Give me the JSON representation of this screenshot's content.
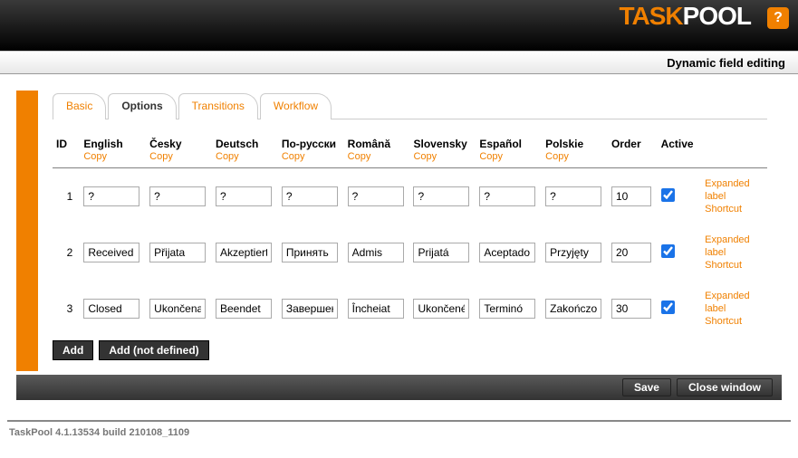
{
  "brand": {
    "part1": "TASK",
    "part2": "POOL"
  },
  "subtitle": "Dynamic field editing",
  "tabs": {
    "basic": "Basic",
    "options": "Options",
    "transitions": "Transitions",
    "workflow": "Workflow"
  },
  "columns": {
    "id": "ID",
    "order": "Order",
    "active": "Active",
    "copy": "Copy"
  },
  "langs": [
    {
      "key": "en",
      "label": "English"
    },
    {
      "key": "cs",
      "label": "Česky"
    },
    {
      "key": "de",
      "label": "Deutsch"
    },
    {
      "key": "ru",
      "label": "По-русски"
    },
    {
      "key": "ro",
      "label": "Română"
    },
    {
      "key": "sk",
      "label": "Slovensky"
    },
    {
      "key": "es",
      "label": "Español"
    },
    {
      "key": "pl",
      "label": "Polskie"
    }
  ],
  "rows": [
    {
      "id": "1",
      "vals": {
        "en": "?",
        "cs": "?",
        "de": "?",
        "ru": "?",
        "ro": "?",
        "sk": "?",
        "es": "?",
        "pl": "?"
      },
      "order": "10",
      "active": true
    },
    {
      "id": "2",
      "vals": {
        "en": "Received",
        "cs": "Přijata",
        "de": "Akzeptiert",
        "ru": "Принять",
        "ro": "Admis",
        "sk": "Prijatá",
        "es": "Aceptado",
        "pl": "Przyjęty"
      },
      "order": "20",
      "active": true
    },
    {
      "id": "3",
      "vals": {
        "en": "Closed",
        "cs": "Ukončena",
        "de": "Beendet",
        "ru": "Завершен",
        "ro": "Încheiat",
        "sk": "Ukončené",
        "es": "Terminó",
        "pl": "Zakończony"
      },
      "order": "30",
      "active": true
    }
  ],
  "row_actions": {
    "expanded": "Expanded label",
    "shortcut": "Shortcut"
  },
  "buttons": {
    "add": "Add",
    "add_nd": "Add (not defined)",
    "save": "Save",
    "close": "Close window"
  },
  "footer": "TaskPool 4.1.13534 build 210108_1109"
}
